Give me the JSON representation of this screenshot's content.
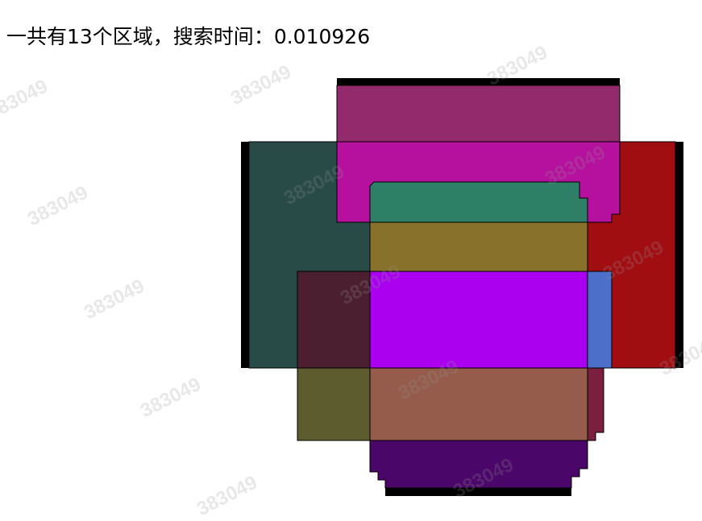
{
  "header": {
    "summary": "一共有13个区域，搜索时间：0.010926"
  },
  "watermark": {
    "text": "383049"
  },
  "regions": [
    {
      "name": "region-top-maroon",
      "color": "#922a6c"
    },
    {
      "name": "region-magenta-arch",
      "color": "#b5119e"
    },
    {
      "name": "region-dark-teal-left",
      "color": "#294b47"
    },
    {
      "name": "region-red-right",
      "color": "#a00e12"
    },
    {
      "name": "region-green",
      "color": "#2d7f66"
    },
    {
      "name": "region-olive",
      "color": "#88712b"
    },
    {
      "name": "region-dark-plum",
      "color": "#4b1f30"
    },
    {
      "name": "region-violet-center",
      "color": "#aa00ef"
    },
    {
      "name": "region-blue",
      "color": "#4c6fc9"
    },
    {
      "name": "region-olive-green-bottom-left",
      "color": "#5d5c2e"
    },
    {
      "name": "region-terracotta",
      "color": "#955c4c"
    },
    {
      "name": "region-crimson-small",
      "color": "#7c1e3e"
    },
    {
      "name": "region-indigo-bottom",
      "color": "#4b066a"
    }
  ]
}
